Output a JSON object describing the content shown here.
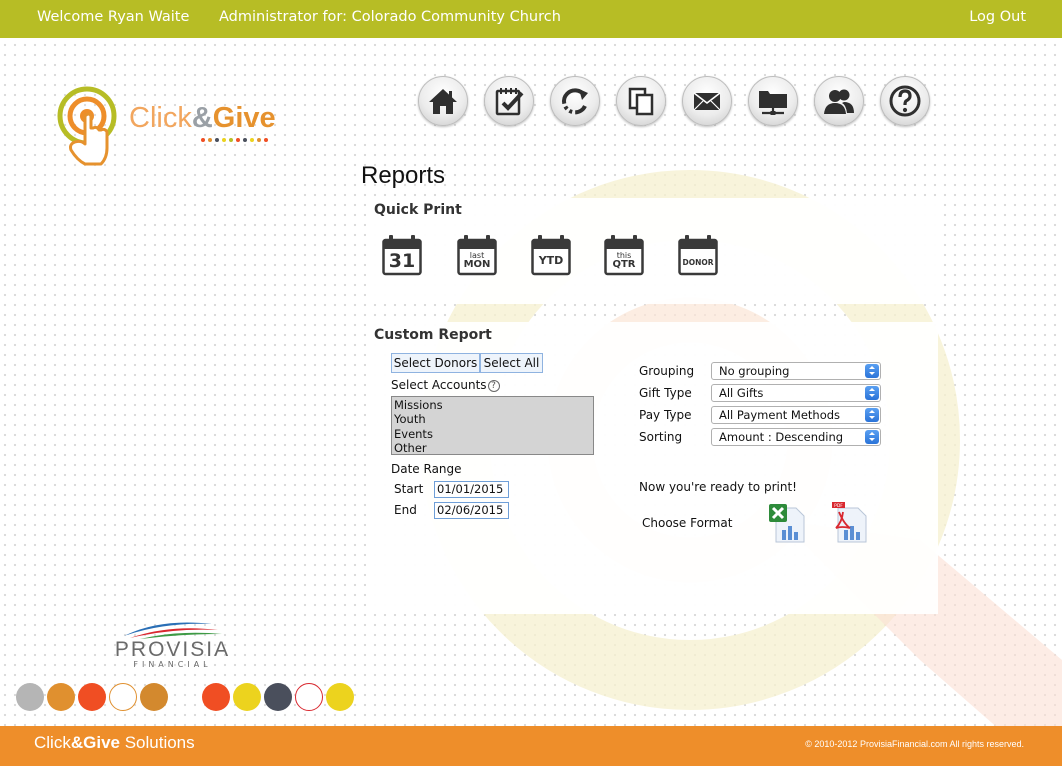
{
  "header": {
    "welcome": "Welcome Ryan Waite",
    "admin_for": "Administrator for: Colorado Community Church",
    "logout": "Log Out"
  },
  "brand": {
    "click": "Click",
    "amp": "&",
    "give": "Give",
    "footer_click": "Click",
    "footer_give": "&Give",
    "footer_suffix": " Solutions",
    "partner_name": "PROVISIA",
    "partner_sub": "FINANCIAL",
    "copyright": "© 2010-2012 ProvisiaFinancial.com  All rights reserved."
  },
  "nav": [
    {
      "icon": "home-icon"
    },
    {
      "icon": "checklist-icon"
    },
    {
      "icon": "refresh-icon"
    },
    {
      "icon": "copy-icon"
    },
    {
      "icon": "mail-icon"
    },
    {
      "icon": "network-folder-icon"
    },
    {
      "icon": "users-icon"
    },
    {
      "icon": "help-icon"
    }
  ],
  "page": {
    "title": "Reports"
  },
  "quick_print": {
    "title": "Quick Print",
    "items": [
      {
        "line1": "31",
        "line2": ""
      },
      {
        "line1": "last",
        "line2": "MON"
      },
      {
        "line1": "YTD",
        "line2": ""
      },
      {
        "line1": "this",
        "line2": "QTR"
      },
      {
        "line1": "DONOR",
        "line2": ""
      }
    ]
  },
  "custom_report": {
    "title": "Custom Report",
    "select_donors": "Select Donors",
    "select_all": "Select All",
    "select_accounts": "Select Accounts",
    "help_glyph": "?",
    "accounts": [
      "Missions",
      "Youth",
      "Events",
      "Other"
    ],
    "date_range_label": "Date Range",
    "start_label": "Start",
    "start_value": "01/01/2015",
    "end_label": "End",
    "end_value": "02/06/2015",
    "grouping_label": "Grouping",
    "grouping_value": "No grouping",
    "gift_type_label": "Gift Type",
    "gift_type_value": "All Gifts",
    "pay_type_label": "Pay Type",
    "pay_type_value": "All Payment Methods",
    "sorting_label": "Sorting",
    "sorting_value": "Amount : Descending",
    "ready_text": "Now you're ready to print!",
    "choose_format": "Choose Format",
    "pdf_tag": "PDF"
  },
  "colors": {
    "header_bg": "#b7bd25",
    "footer_bg": "#ee8e2a",
    "brand_orange": "#e6922e",
    "input_border": "#6f9fd8",
    "select_arrow": "#2a73d8",
    "excel_green": "#2e8b3a",
    "pdf_red": "#d9282f"
  },
  "decor_dots": [
    "#b5b5b5",
    "#e0902f",
    "#f04e23",
    "#ffffff",
    "#d3892e",
    "#f04e23",
    "#ecd31e",
    "#4a4f5c",
    "#ffffff",
    "#ecd31e"
  ]
}
